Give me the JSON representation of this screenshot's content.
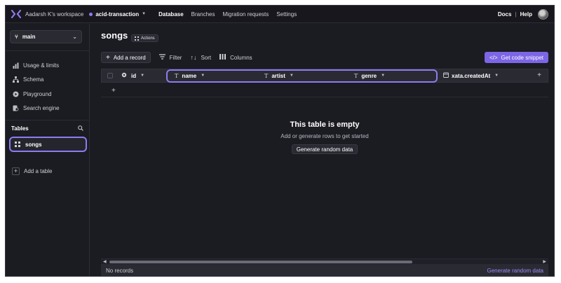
{
  "topbar": {
    "workspace": "Aadarsh K's workspace",
    "database": "acid-transaction",
    "nav": [
      "Database",
      "Branches",
      "Migration requests",
      "Settings"
    ],
    "active_nav": "Database",
    "docs": "Docs",
    "separator": "|",
    "help": "Help"
  },
  "sidebar": {
    "branch": "main",
    "items": [
      {
        "label": "Usage & limits",
        "icon": "bar-chart-icon"
      },
      {
        "label": "Schema",
        "icon": "schema-icon"
      },
      {
        "label": "Playground",
        "icon": "playground-icon"
      },
      {
        "label": "Search engine",
        "icon": "search-engine-icon"
      }
    ],
    "tables_heading": "Tables",
    "tables": [
      {
        "label": "songs",
        "selected": true
      }
    ],
    "add_table": "Add a table"
  },
  "main": {
    "title": "songs",
    "actions_label": "Actions",
    "toolbar": {
      "add_record": "Add a record",
      "filter": "Filter",
      "sort": "Sort",
      "columns": "Columns",
      "get_code_snippet": "Get code snippet"
    },
    "columns": [
      {
        "name": "id",
        "type_icon": "key-icon"
      },
      {
        "name": "name",
        "type_icon": "text-type-icon"
      },
      {
        "name": "artist",
        "type_icon": "text-type-icon"
      },
      {
        "name": "genre",
        "type_icon": "text-type-icon"
      },
      {
        "name": "xata.createdAt",
        "type_icon": "calendar-icon"
      }
    ],
    "empty": {
      "title": "This table is empty",
      "subtitle": "Add or generate rows to get started",
      "button": "Generate random data"
    },
    "footer": {
      "records": "No records",
      "generate": "Generate random data"
    }
  },
  "colors": {
    "accent": "#8b7cf0",
    "button_primary": "#7c66e6",
    "background": "#1b1b22"
  }
}
